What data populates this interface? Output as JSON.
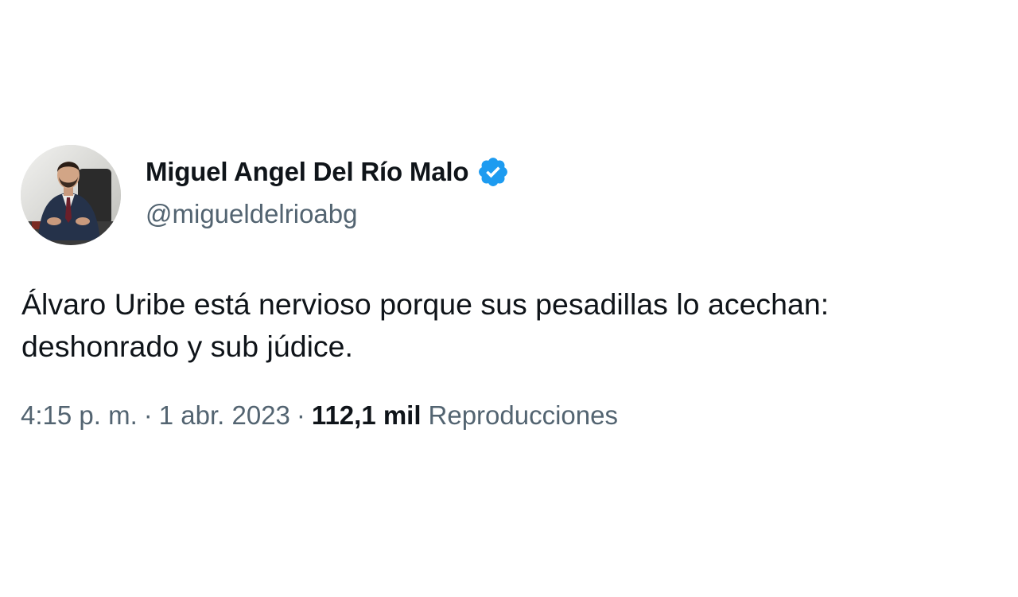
{
  "author": {
    "display_name": "Miguel Angel Del Río Malo",
    "handle": "@migueldelrioabg",
    "verified": true,
    "verified_badge_color": "#1d9bf0"
  },
  "tweet": {
    "text": "Álvaro Uribe está nervioso porque sus pesadillas lo acechan:\ndeshonrado y sub júdice."
  },
  "meta": {
    "time": "4:15 p. m.",
    "separator": "·",
    "date": "1 abr. 2023",
    "views_count": "112,1 mil",
    "views_label": "Reproducciones"
  },
  "colors": {
    "text_primary": "#0f1419",
    "text_secondary": "#536471",
    "background": "#ffffff"
  }
}
